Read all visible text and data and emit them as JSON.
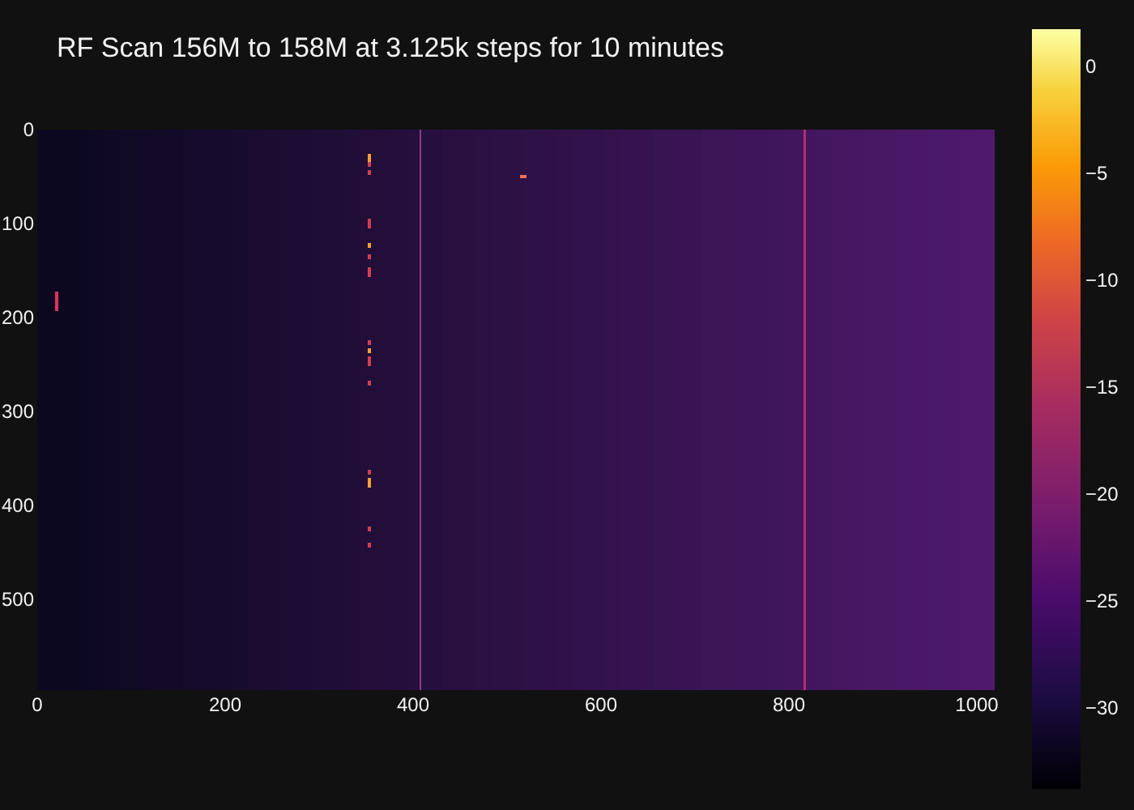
{
  "title": "RF Scan 156M to 158M at 3.125k steps for 10 minutes",
  "y_axis": {
    "ticks": [
      "0",
      "100",
      "200",
      "300",
      "400",
      "500"
    ]
  },
  "x_axis": {
    "ticks": [
      "0",
      "200",
      "400",
      "600",
      "800",
      "1000"
    ]
  },
  "colorbar": {
    "ticks": [
      "0",
      "−5",
      "−10",
      "−15",
      "−20",
      "−25",
      "−30"
    ]
  }
}
